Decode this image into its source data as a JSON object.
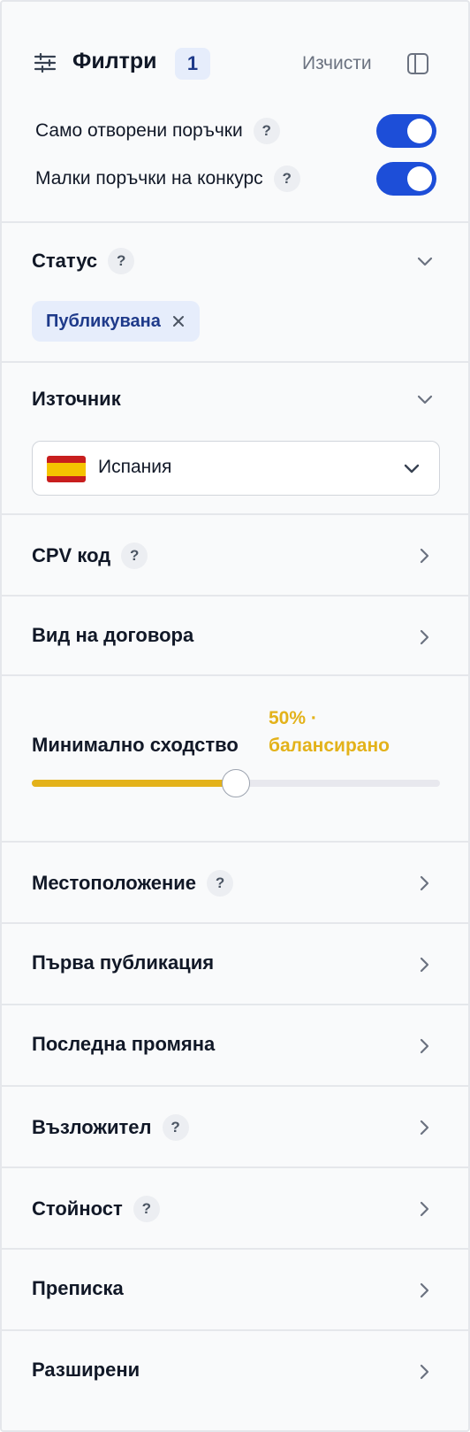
{
  "header": {
    "title": "Филтри",
    "count": "1",
    "clear_label": "Изчисти"
  },
  "toggles": [
    {
      "label": "Само отворени поръчки",
      "on": true
    },
    {
      "label": "Малки поръчки на конкурс",
      "on": true
    }
  ],
  "help_glyph": "?",
  "status": {
    "title": "Статус",
    "chip_label": "Публикувана"
  },
  "source": {
    "title": "Източник",
    "selected": "Испания",
    "flag_icon": "spain-flag-icon"
  },
  "cpv": {
    "title": "CPV код"
  },
  "contract_type": {
    "title": "Вид на договора"
  },
  "similarity": {
    "title": "Минимално сходство",
    "value_label": "50% · балансирано",
    "value": 0.5
  },
  "rows": {
    "location": "Местоположение",
    "first_publication": "Първа публикация",
    "last_change": "Последна промяна",
    "contracting_authority": "Възложител",
    "value": "Стойност",
    "correspondence": "Преписка",
    "advanced": "Разширени"
  },
  "colors": {
    "accent_blue": "#1d4ed8",
    "chip_bg": "#e6edfb",
    "slider_yellow": "#e3b21a"
  }
}
